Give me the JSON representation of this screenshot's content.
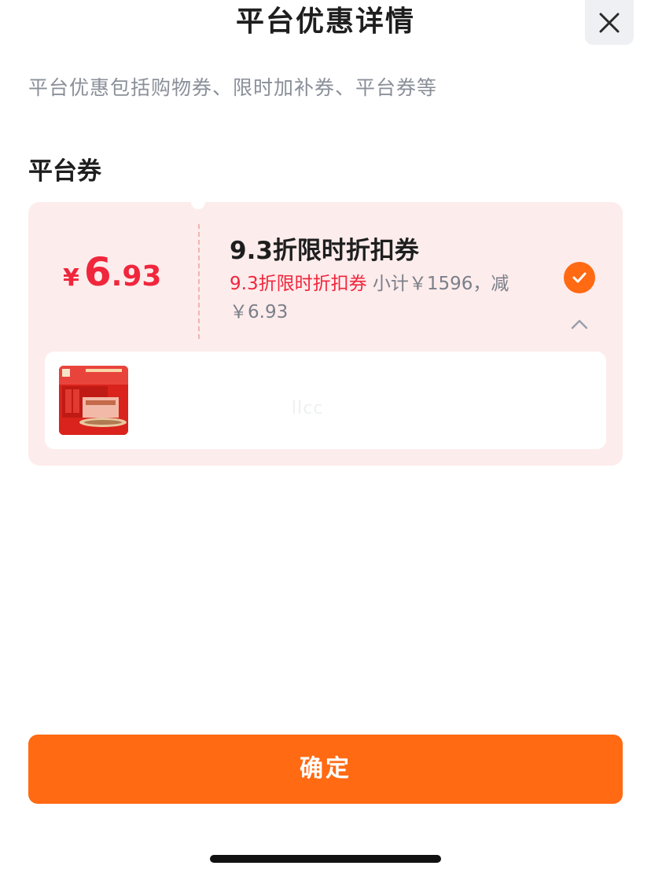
{
  "header": {
    "title": "平台优惠详情",
    "close_icon": "close-icon"
  },
  "description": "平台优惠包括购物券、限时加补券、平台券等",
  "section": {
    "title": "平台券"
  },
  "coupon": {
    "currency": "¥",
    "amount_int": "6",
    "amount_dec": ".93",
    "name": "9.3折限时折扣券",
    "desc_highlight": "9.3折限时折扣券",
    "desc_rest": " 小计￥1596，减￥6.93",
    "selected": true,
    "expanded": true,
    "check_icon": "check-icon",
    "collapse_icon": "chevron-up-icon"
  },
  "product": {
    "thumbnail": "product-gift-box-image",
    "watermark": "llcc"
  },
  "footer": {
    "confirm_label": "确定"
  },
  "colors": {
    "accent": "#ff6a13",
    "price_red": "#f0263c",
    "card_bg": "#fdecec",
    "muted_text": "#8a8f99"
  }
}
